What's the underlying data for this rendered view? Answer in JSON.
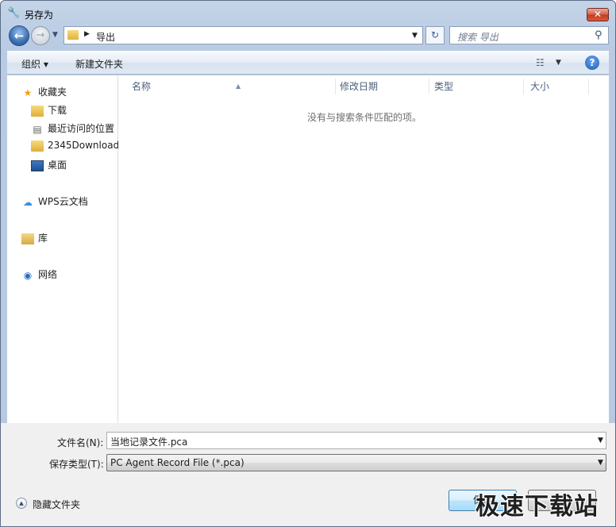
{
  "window": {
    "title": "另存为"
  },
  "address": {
    "current": "导出"
  },
  "search": {
    "placeholder": "搜索 导出"
  },
  "toolbar": {
    "organize": "组织 ▾",
    "new_folder": "新建文件夹"
  },
  "sidebar": {
    "items": [
      {
        "label": "收藏夹",
        "icon": "star-icon"
      },
      {
        "label": "下载",
        "icon": "folder-icon"
      },
      {
        "label": "最近访问的位置",
        "icon": "recent-places-icon"
      },
      {
        "label": "2345Download",
        "icon": "folder-icon"
      },
      {
        "label": "桌面",
        "icon": "desktop-icon"
      },
      {
        "label": "WPS云文档",
        "icon": "cloud-icon"
      },
      {
        "label": "库",
        "icon": "library-icon"
      },
      {
        "label": "网络",
        "icon": "network-icon"
      }
    ]
  },
  "file_list": {
    "columns": [
      "名称",
      "修改日期",
      "类型",
      "大小"
    ],
    "empty_message": "没有与搜索条件匹配的项。"
  },
  "form": {
    "filename_label": "文件名(N):",
    "filename_value": "当地记录文件.pca",
    "filetype_label": "保存类型(T):",
    "filetype_value": "PC Agent Record File (*.pca)"
  },
  "footer": {
    "hide_folders": "隐藏文件夹",
    "save": "保存",
    "cancel": "取消"
  },
  "watermark": "极速下载站"
}
